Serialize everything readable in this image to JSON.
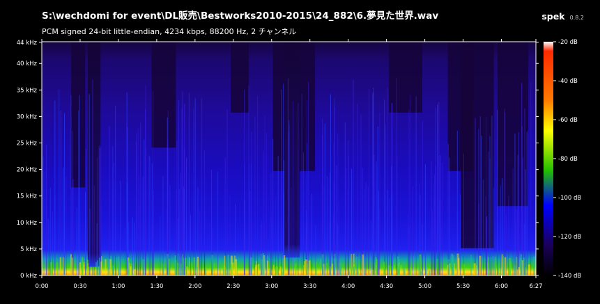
{
  "header": {
    "file_path": "S:\\wechdomi for event\\DL販売\\Bestworks2010-2015\\24_882\\6.夢見た世界.wav",
    "audio_info": "PCM signed 24-bit little-endian, 4234 kbps, 88200 Hz, 2 チャンネル",
    "app_name": "spek",
    "app_version": "0.8.2"
  },
  "frequency_axis": {
    "labels": [
      "0 kHz",
      "5 kHz",
      "10 kHz",
      "15 kHz",
      "20 kHz",
      "25 kHz",
      "30 kHz",
      "35 kHz",
      "40 kHz",
      "44 kHz"
    ],
    "values_khz": [
      0,
      5,
      10,
      15,
      20,
      25,
      30,
      35,
      40,
      44
    ],
    "max_khz": 44.1
  },
  "time_axis": {
    "labels": [
      "0:00",
      "0:30",
      "1:00",
      "1:30",
      "2:00",
      "2:30",
      "3:00",
      "3:30",
      "4:00",
      "4:30",
      "5:00",
      "5:30",
      "6:00",
      "6:27"
    ],
    "values_sec": [
      0,
      30,
      60,
      90,
      120,
      150,
      180,
      210,
      240,
      270,
      300,
      330,
      360,
      387
    ],
    "duration_sec": 387
  },
  "color_scale": {
    "labels": [
      "-20 dB",
      "-40 dB",
      "-60 dB",
      "-80 dB",
      "-100 dB",
      "-120 dB",
      "-140 dB"
    ],
    "values_db": [
      -20,
      -40,
      -60,
      -80,
      -100,
      -120,
      -140
    ],
    "stops": [
      "#ffffff",
      "#ff2a00",
      "#ffff00",
      "#22c000",
      "#0000ff",
      "#1a005a",
      "#000000"
    ]
  },
  "colors": {
    "background": "#000000",
    "quiet_band": "#170542",
    "body_blue": "#1a0fcf",
    "low_green": "#40d010",
    "low_yellow": "#ffe020"
  }
}
